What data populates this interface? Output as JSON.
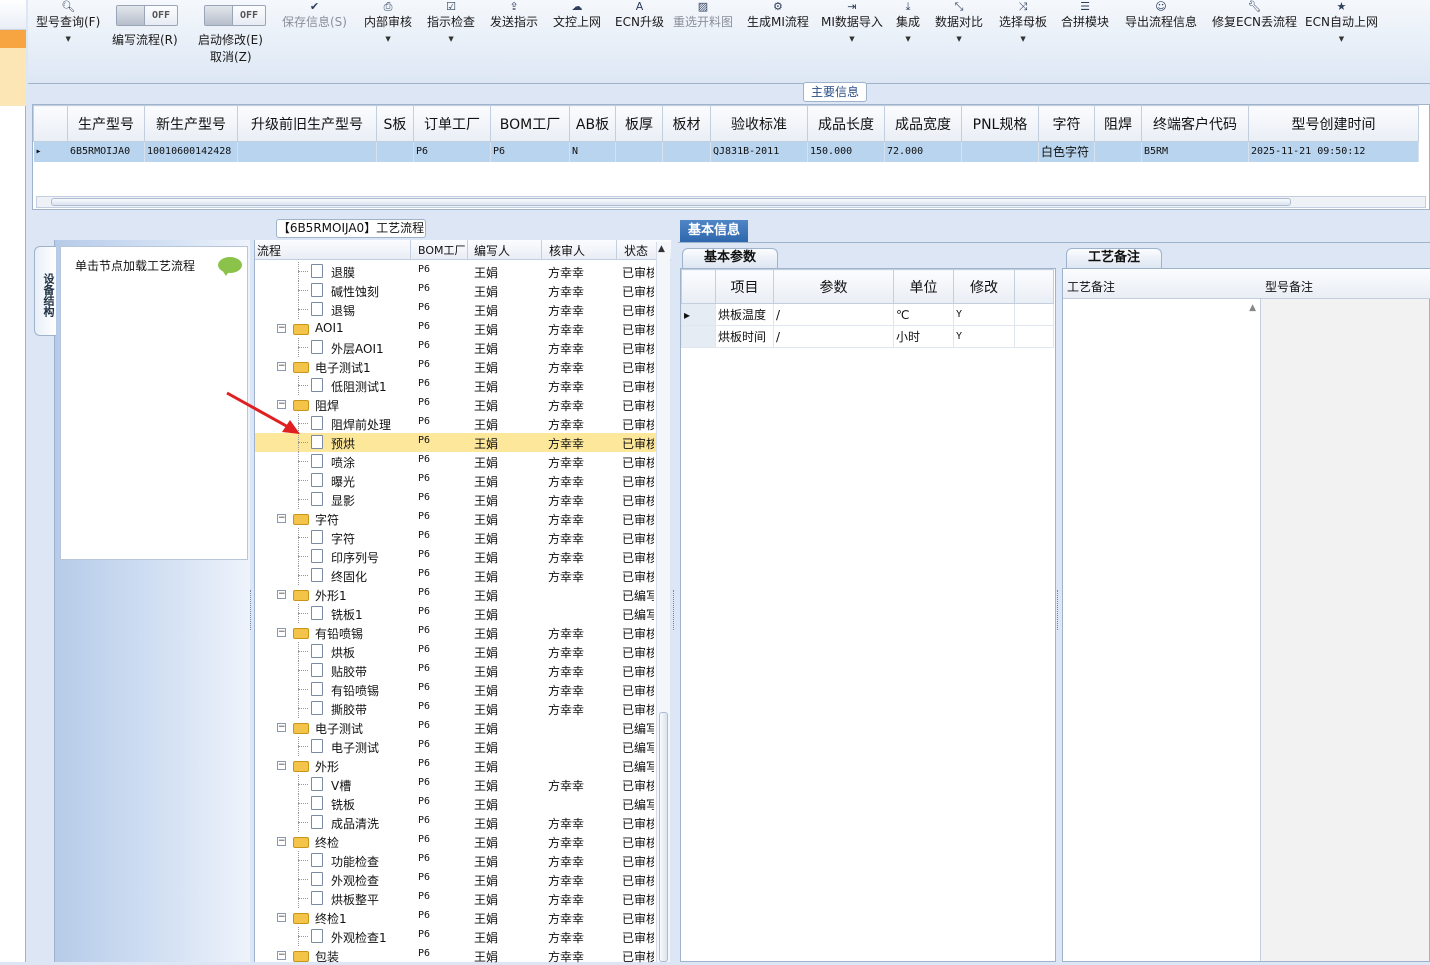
{
  "toolbar": {
    "model_query": "型号查询(F)",
    "edit_flow": "编写流程(R)",
    "edit_flow_toggle": "OFF",
    "auto_modify": "启动修改(E)",
    "auto_modify_toggle": "OFF",
    "cancel": "取消(Z)",
    "save_info": "保存信息(S)",
    "internal_review": "内部审核",
    "instruction_check": "指示检查",
    "send_instruction": "发送指示",
    "doc_upload": "文控上网",
    "ecn_upgrade": "ECN升级",
    "reselect_cut": "重选开料图",
    "generate_mi": "生成MI流程",
    "mi_import": "MI数据导入",
    "integrate": "集成",
    "data_compare": "数据对比",
    "select_mother": "选择母板",
    "combine_module": "合拼模块",
    "export_flow": "导出流程信息",
    "repair_ecn": "修复ECN丢流程",
    "ecn_auto_upload": "ECN自动上网"
  },
  "main_info": {
    "label": "主要信息",
    "columns": [
      "生产型号",
      "新生产型号",
      "升级前旧生产型号",
      "S板",
      "订单工厂",
      "BOM工厂",
      "AB板",
      "板厚",
      "板材",
      "验收标准",
      "成品长度",
      "成品宽度",
      "PNL规格",
      "字符",
      "阻焊",
      "终端客户代码",
      "型号创建时间"
    ],
    "row": [
      "6B5RMOIJA0",
      "10010600142428",
      "",
      "",
      "P6",
      "P6",
      "N",
      "",
      "",
      "QJ831B-2011",
      "150.000",
      "72.000",
      "",
      "白色字符",
      "",
      "B5RM",
      "2025-11-21 09:50:12"
    ]
  },
  "side": {
    "tab_label": "设备结构",
    "hint": "单击节点加载工艺流程"
  },
  "tree": {
    "title": "【6B5RMOIJA0】工艺流程",
    "headers": {
      "flow": "流程",
      "bom": "BOM工厂",
      "writer": "编写人",
      "reviewer": "核审人",
      "status": "状态"
    },
    "rows": [
      {
        "name": "退膜",
        "level": 2,
        "bom": "P6",
        "writer": "王娟",
        "reviewer": "方幸幸",
        "status": "已审核"
      },
      {
        "name": "碱性蚀刻",
        "level": 2,
        "bom": "P6",
        "writer": "王娟",
        "reviewer": "方幸幸",
        "status": "已审核"
      },
      {
        "name": "退锡",
        "level": 2,
        "bom": "P6",
        "writer": "王娟",
        "reviewer": "方幸幸",
        "status": "已审核"
      },
      {
        "name": "AOI1",
        "level": 1,
        "bom": "P6",
        "writer": "王娟",
        "reviewer": "方幸幸",
        "status": "已审核"
      },
      {
        "name": "外层AOI1",
        "level": 2,
        "bom": "P6",
        "writer": "王娟",
        "reviewer": "方幸幸",
        "status": "已审核"
      },
      {
        "name": "电子测试1",
        "level": 1,
        "bom": "P6",
        "writer": "王娟",
        "reviewer": "方幸幸",
        "status": "已审核"
      },
      {
        "name": "低阻测试1",
        "level": 2,
        "bom": "P6",
        "writer": "王娟",
        "reviewer": "方幸幸",
        "status": "已审核"
      },
      {
        "name": "阻焊",
        "level": 1,
        "bom": "P6",
        "writer": "王娟",
        "reviewer": "方幸幸",
        "status": "已审核"
      },
      {
        "name": "阻焊前处理",
        "level": 2,
        "bom": "P6",
        "writer": "王娟",
        "reviewer": "方幸幸",
        "status": "已审核"
      },
      {
        "name": "预烘",
        "level": 2,
        "bom": "P6",
        "writer": "王娟",
        "reviewer": "方幸幸",
        "status": "已审核",
        "selected": true
      },
      {
        "name": "喷涂",
        "level": 2,
        "bom": "P6",
        "writer": "王娟",
        "reviewer": "方幸幸",
        "status": "已审核"
      },
      {
        "name": "曝光",
        "level": 2,
        "bom": "P6",
        "writer": "王娟",
        "reviewer": "方幸幸",
        "status": "已审核"
      },
      {
        "name": "显影",
        "level": 2,
        "bom": "P6",
        "writer": "王娟",
        "reviewer": "方幸幸",
        "status": "已审核"
      },
      {
        "name": "字符",
        "level": 1,
        "bom": "P6",
        "writer": "王娟",
        "reviewer": "方幸幸",
        "status": "已审核"
      },
      {
        "name": "字符",
        "level": 2,
        "bom": "P6",
        "writer": "王娟",
        "reviewer": "方幸幸",
        "status": "已审核"
      },
      {
        "name": "印序列号",
        "level": 2,
        "bom": "P6",
        "writer": "王娟",
        "reviewer": "方幸幸",
        "status": "已审核"
      },
      {
        "name": "终固化",
        "level": 2,
        "bom": "P6",
        "writer": "王娟",
        "reviewer": "方幸幸",
        "status": "已审核"
      },
      {
        "name": "外形1",
        "level": 1,
        "bom": "P6",
        "writer": "王娟",
        "reviewer": "",
        "status": "已编写"
      },
      {
        "name": "铣板1",
        "level": 2,
        "bom": "P6",
        "writer": "王娟",
        "reviewer": "",
        "status": "已编写"
      },
      {
        "name": "有铅喷锡",
        "level": 1,
        "bom": "P6",
        "writer": "王娟",
        "reviewer": "方幸幸",
        "status": "已审核"
      },
      {
        "name": "烘板",
        "level": 2,
        "bom": "P6",
        "writer": "王娟",
        "reviewer": "方幸幸",
        "status": "已审核"
      },
      {
        "name": "贴胶带",
        "level": 2,
        "bom": "P6",
        "writer": "王娟",
        "reviewer": "方幸幸",
        "status": "已审核"
      },
      {
        "name": "有铅喷锡",
        "level": 2,
        "bom": "P6",
        "writer": "王娟",
        "reviewer": "方幸幸",
        "status": "已审核"
      },
      {
        "name": "撕胶带",
        "level": 2,
        "bom": "P6",
        "writer": "王娟",
        "reviewer": "方幸幸",
        "status": "已审核"
      },
      {
        "name": "电子测试",
        "level": 1,
        "bom": "P6",
        "writer": "王娟",
        "reviewer": "",
        "status": "已编写"
      },
      {
        "name": "电子测试",
        "level": 2,
        "bom": "P6",
        "writer": "王娟",
        "reviewer": "",
        "status": "已编写"
      },
      {
        "name": "外形",
        "level": 1,
        "bom": "P6",
        "writer": "王娟",
        "reviewer": "",
        "status": "已编写"
      },
      {
        "name": "V槽",
        "level": 2,
        "bom": "P6",
        "writer": "王娟",
        "reviewer": "方幸幸",
        "status": "已审核"
      },
      {
        "name": "铣板",
        "level": 2,
        "bom": "P6",
        "writer": "王娟",
        "reviewer": "",
        "status": "已编写"
      },
      {
        "name": "成品清洗",
        "level": 2,
        "bom": "P6",
        "writer": "王娟",
        "reviewer": "方幸幸",
        "status": "已审核"
      },
      {
        "name": "终检",
        "level": 1,
        "bom": "P6",
        "writer": "王娟",
        "reviewer": "方幸幸",
        "status": "已审核"
      },
      {
        "name": "功能检查",
        "level": 2,
        "bom": "P6",
        "writer": "王娟",
        "reviewer": "方幸幸",
        "status": "已审核"
      },
      {
        "name": "外观检查",
        "level": 2,
        "bom": "P6",
        "writer": "王娟",
        "reviewer": "方幸幸",
        "status": "已审核"
      },
      {
        "name": "烘板整平",
        "level": 2,
        "bom": "P6",
        "writer": "王娟",
        "reviewer": "方幸幸",
        "status": "已审核"
      },
      {
        "name": "终检1",
        "level": 1,
        "bom": "P6",
        "writer": "王娟",
        "reviewer": "方幸幸",
        "status": "已审核"
      },
      {
        "name": "外观检查1",
        "level": 2,
        "bom": "P6",
        "writer": "王娟",
        "reviewer": "方幸幸",
        "status": "已审核"
      },
      {
        "name": "包装",
        "level": 1,
        "bom": "P6",
        "writer": "王娟",
        "reviewer": "方幸幸",
        "status": "已审核"
      }
    ]
  },
  "basic": {
    "tab": "基本信息",
    "params_tab": "基本参数",
    "param_headers": [
      "项目",
      "参数",
      "单位",
      "修改"
    ],
    "params": [
      {
        "item": "烘板温度",
        "value": "/",
        "unit": "℃",
        "modify": "Y"
      },
      {
        "item": "烘板时间",
        "value": "/",
        "unit": "小时",
        "modify": "Y"
      }
    ],
    "notes_tab": "工艺备注",
    "notes_headers": [
      "工艺备注",
      "型号备注"
    ]
  },
  "colors": {
    "selection": "#fde79a",
    "row_selected": "#b9d4ef",
    "accent": "#2e67ad",
    "arrow": "#e02020"
  }
}
